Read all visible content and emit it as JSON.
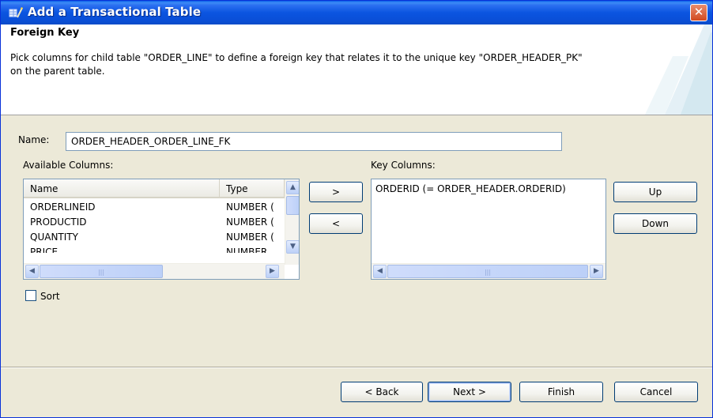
{
  "window": {
    "title": "Add a Transactional Table",
    "close_glyph": "✕"
  },
  "header": {
    "title": "Foreign Key",
    "description": "Pick columns for child table \"ORDER_LINE\" to define a foreign key that relates it to the unique key \"ORDER_HEADER_PK\" on the parent table."
  },
  "form": {
    "name_label": "Name:",
    "name_value": "ORDER_HEADER_ORDER_LINE_FK",
    "available_label": "Available Columns:",
    "key_label": "Key Columns:",
    "sort_label": "Sort",
    "sort_checked": false
  },
  "available_columns": {
    "headers": [
      "Name",
      "Type"
    ],
    "rows": [
      {
        "name": "ORDERLINEID",
        "type": "NUMBER ("
      },
      {
        "name": "PRODUCTID",
        "type": "NUMBER ("
      },
      {
        "name": "QUANTITY",
        "type": "NUMBER ("
      },
      {
        "name": "PRICE",
        "type": "NUMBER"
      }
    ]
  },
  "key_columns": {
    "items": [
      "ORDERID (= ORDER_HEADER.ORDERID)"
    ]
  },
  "transfer": {
    "add_label": ">",
    "remove_label": "<"
  },
  "ordering": {
    "up_label": "Up",
    "down_label": "Down"
  },
  "footer": {
    "back_label": "< Back",
    "next_label": "Next >",
    "finish_label": "Finish",
    "cancel_label": "Cancel"
  },
  "icons": {
    "scroll_up": "▲",
    "scroll_down": "▼",
    "scroll_left": "◀",
    "scroll_right": "▶",
    "grip": "|||"
  },
  "colors": {
    "titlebar": "#0a55e0",
    "dialog_bg": "#ece9d8",
    "close": "#d14a20",
    "field_border": "#7f9db9"
  }
}
